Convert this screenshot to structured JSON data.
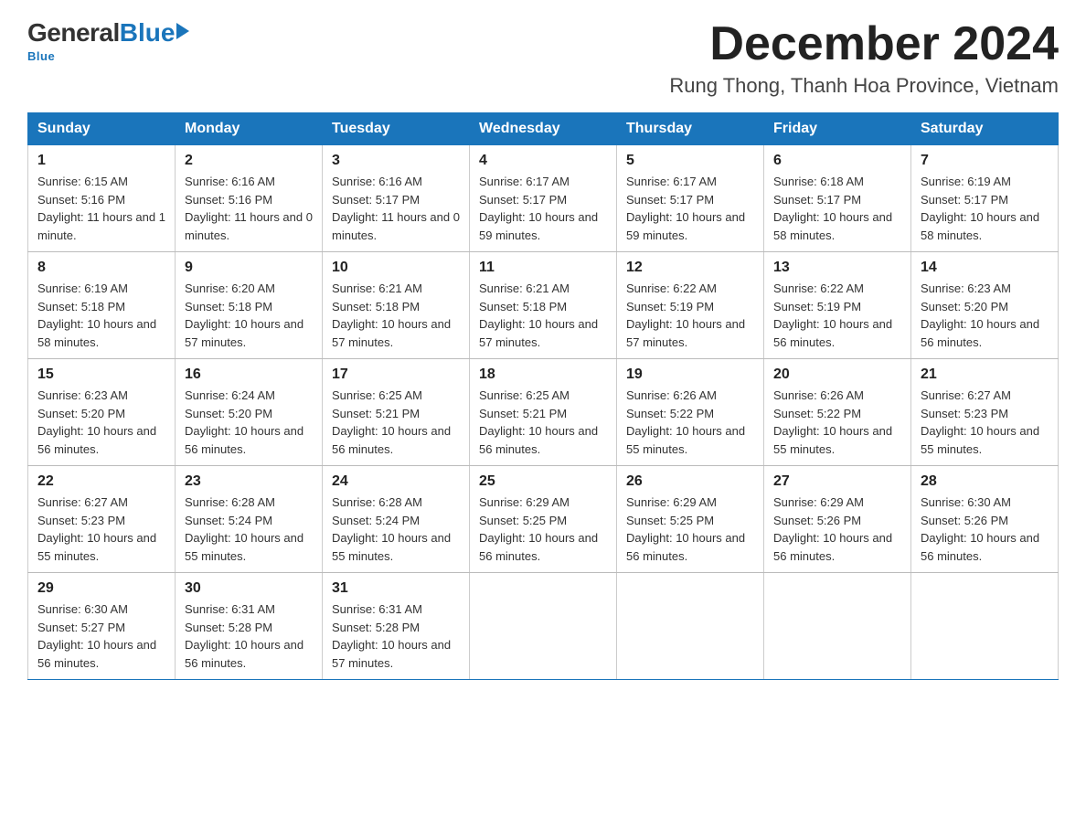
{
  "logo": {
    "general": "General",
    "blue": "Blue",
    "underline": "Blue"
  },
  "header": {
    "month_year": "December 2024",
    "location": "Rung Thong, Thanh Hoa Province, Vietnam"
  },
  "weekdays": [
    "Sunday",
    "Monday",
    "Tuesday",
    "Wednesday",
    "Thursday",
    "Friday",
    "Saturday"
  ],
  "weeks": [
    [
      {
        "day": "1",
        "sunrise": "6:15 AM",
        "sunset": "5:16 PM",
        "daylight": "11 hours and 1 minute."
      },
      {
        "day": "2",
        "sunrise": "6:16 AM",
        "sunset": "5:16 PM",
        "daylight": "11 hours and 0 minutes."
      },
      {
        "day": "3",
        "sunrise": "6:16 AM",
        "sunset": "5:17 PM",
        "daylight": "11 hours and 0 minutes."
      },
      {
        "day": "4",
        "sunrise": "6:17 AM",
        "sunset": "5:17 PM",
        "daylight": "10 hours and 59 minutes."
      },
      {
        "day": "5",
        "sunrise": "6:17 AM",
        "sunset": "5:17 PM",
        "daylight": "10 hours and 59 minutes."
      },
      {
        "day": "6",
        "sunrise": "6:18 AM",
        "sunset": "5:17 PM",
        "daylight": "10 hours and 58 minutes."
      },
      {
        "day": "7",
        "sunrise": "6:19 AM",
        "sunset": "5:17 PM",
        "daylight": "10 hours and 58 minutes."
      }
    ],
    [
      {
        "day": "8",
        "sunrise": "6:19 AM",
        "sunset": "5:18 PM",
        "daylight": "10 hours and 58 minutes."
      },
      {
        "day": "9",
        "sunrise": "6:20 AM",
        "sunset": "5:18 PM",
        "daylight": "10 hours and 57 minutes."
      },
      {
        "day": "10",
        "sunrise": "6:21 AM",
        "sunset": "5:18 PM",
        "daylight": "10 hours and 57 minutes."
      },
      {
        "day": "11",
        "sunrise": "6:21 AM",
        "sunset": "5:18 PM",
        "daylight": "10 hours and 57 minutes."
      },
      {
        "day": "12",
        "sunrise": "6:22 AM",
        "sunset": "5:19 PM",
        "daylight": "10 hours and 57 minutes."
      },
      {
        "day": "13",
        "sunrise": "6:22 AM",
        "sunset": "5:19 PM",
        "daylight": "10 hours and 56 minutes."
      },
      {
        "day": "14",
        "sunrise": "6:23 AM",
        "sunset": "5:20 PM",
        "daylight": "10 hours and 56 minutes."
      }
    ],
    [
      {
        "day": "15",
        "sunrise": "6:23 AM",
        "sunset": "5:20 PM",
        "daylight": "10 hours and 56 minutes."
      },
      {
        "day": "16",
        "sunrise": "6:24 AM",
        "sunset": "5:20 PM",
        "daylight": "10 hours and 56 minutes."
      },
      {
        "day": "17",
        "sunrise": "6:25 AM",
        "sunset": "5:21 PM",
        "daylight": "10 hours and 56 minutes."
      },
      {
        "day": "18",
        "sunrise": "6:25 AM",
        "sunset": "5:21 PM",
        "daylight": "10 hours and 56 minutes."
      },
      {
        "day": "19",
        "sunrise": "6:26 AM",
        "sunset": "5:22 PM",
        "daylight": "10 hours and 55 minutes."
      },
      {
        "day": "20",
        "sunrise": "6:26 AM",
        "sunset": "5:22 PM",
        "daylight": "10 hours and 55 minutes."
      },
      {
        "day": "21",
        "sunrise": "6:27 AM",
        "sunset": "5:23 PM",
        "daylight": "10 hours and 55 minutes."
      }
    ],
    [
      {
        "day": "22",
        "sunrise": "6:27 AM",
        "sunset": "5:23 PM",
        "daylight": "10 hours and 55 minutes."
      },
      {
        "day": "23",
        "sunrise": "6:28 AM",
        "sunset": "5:24 PM",
        "daylight": "10 hours and 55 minutes."
      },
      {
        "day": "24",
        "sunrise": "6:28 AM",
        "sunset": "5:24 PM",
        "daylight": "10 hours and 55 minutes."
      },
      {
        "day": "25",
        "sunrise": "6:29 AM",
        "sunset": "5:25 PM",
        "daylight": "10 hours and 56 minutes."
      },
      {
        "day": "26",
        "sunrise": "6:29 AM",
        "sunset": "5:25 PM",
        "daylight": "10 hours and 56 minutes."
      },
      {
        "day": "27",
        "sunrise": "6:29 AM",
        "sunset": "5:26 PM",
        "daylight": "10 hours and 56 minutes."
      },
      {
        "day": "28",
        "sunrise": "6:30 AM",
        "sunset": "5:26 PM",
        "daylight": "10 hours and 56 minutes."
      }
    ],
    [
      {
        "day": "29",
        "sunrise": "6:30 AM",
        "sunset": "5:27 PM",
        "daylight": "10 hours and 56 minutes."
      },
      {
        "day": "30",
        "sunrise": "6:31 AM",
        "sunset": "5:28 PM",
        "daylight": "10 hours and 56 minutes."
      },
      {
        "day": "31",
        "sunrise": "6:31 AM",
        "sunset": "5:28 PM",
        "daylight": "10 hours and 57 minutes."
      },
      null,
      null,
      null,
      null
    ]
  ]
}
